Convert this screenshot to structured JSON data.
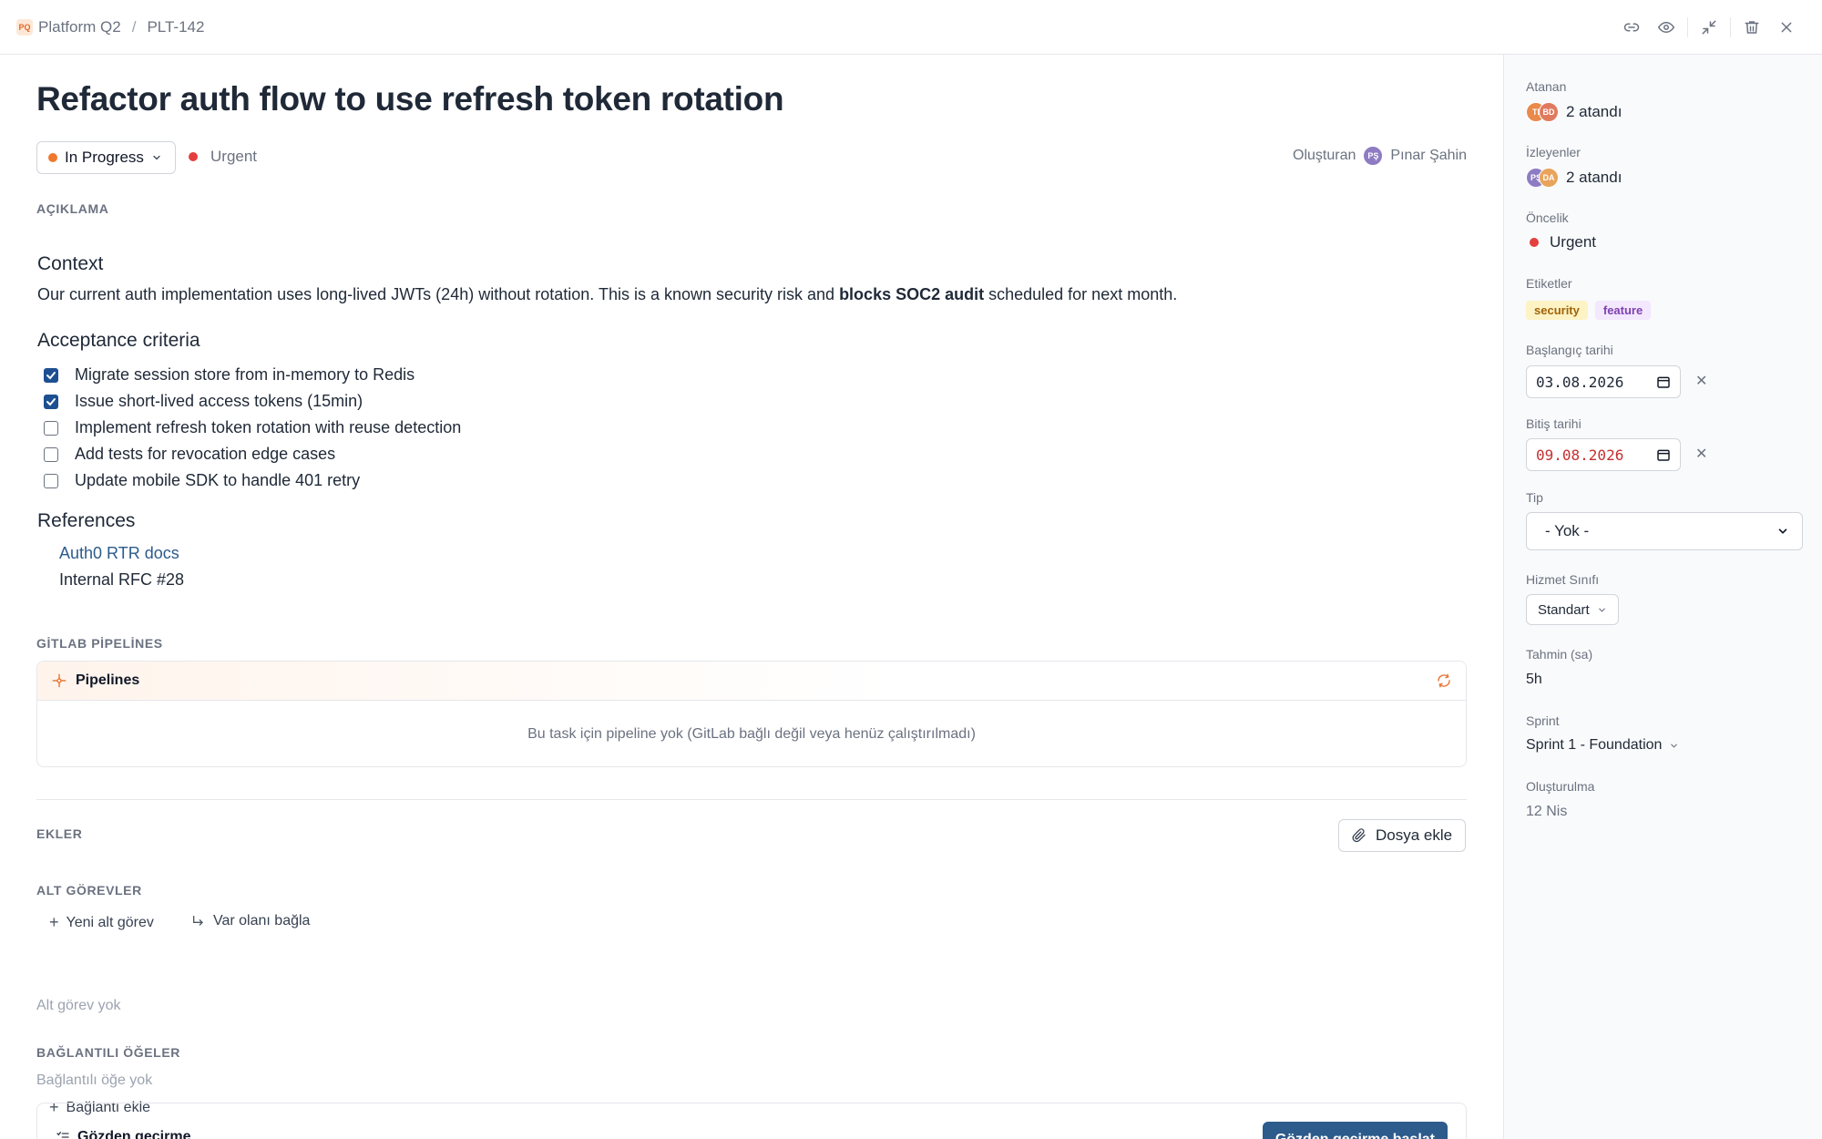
{
  "breadcrumb": {
    "project_badge": "PQ",
    "project": "Platform Q2",
    "separator": "/",
    "issue_key": "PLT-142"
  },
  "issue": {
    "title": "Refactor auth flow to use refresh token rotation",
    "status": "In Progress",
    "status_color": "#f0782e",
    "priority": "Urgent",
    "priority_color": "#e53e3e",
    "creator_label": "Oluşturan",
    "creator_initials": "PŞ",
    "creator_name": "Pınar Şahin"
  },
  "description": {
    "label": "AÇIKLAMA",
    "context_heading": "Context",
    "context_text_before": "Our current auth implementation uses long-lived JWTs (24h) without rotation. This is a known security risk and ",
    "context_text_bold": "blocks SOC2 audit",
    "context_text_after": " scheduled for next month.",
    "acceptance_heading": "Acceptance criteria",
    "checklist": [
      {
        "text": "Migrate session store from in-memory to Redis",
        "checked": true
      },
      {
        "text": "Issue short-lived access tokens (15min)",
        "checked": true
      },
      {
        "text": "Implement refresh token rotation with reuse detection",
        "checked": false
      },
      {
        "text": "Add tests for revocation edge cases",
        "checked": false
      },
      {
        "text": "Update mobile SDK to handle 401 retry",
        "checked": false
      }
    ],
    "references_heading": "References",
    "references": [
      {
        "text": "Auth0 RTR docs",
        "link": true
      },
      {
        "text": "Internal RFC #28",
        "link": false
      }
    ]
  },
  "gitlab": {
    "label": "GİTLAB PİPELİNES",
    "panel_title": "Pipelines",
    "empty_text": "Bu task için pipeline yok (GitLab bağlı değil veya henüz çalıştırılmadı)"
  },
  "attachments": {
    "label": "EKLER",
    "add_button": "Dosya ekle"
  },
  "subtasks": {
    "label": "ALT GÖREVLER",
    "new_button": "Yeni alt görev",
    "link_button": "Var olanı bağla",
    "empty": "Alt görev yok"
  },
  "linked": {
    "label": "BAĞLANTILI ÖĞELER",
    "empty": "Bağlantılı öğe yok",
    "add_button": "Bağlantı ekle"
  },
  "review": {
    "title": "Gözden geçirme",
    "start_button": "Gözden geçirme başlat"
  },
  "sidebar": {
    "assignee_label": "Atanan",
    "assignee_avatars": [
      {
        "initials": "TI",
        "color": "#e9894a"
      },
      {
        "initials": "BD",
        "color": "#e07a5f"
      }
    ],
    "assignee_value": "2 atandı",
    "watchers_label": "İzleyenler",
    "watcher_avatars": [
      {
        "initials": "PŞ",
        "color": "#8e7cc3"
      },
      {
        "initials": "DA",
        "color": "#e8a45c"
      }
    ],
    "watchers_value": "2 atandı",
    "priority_label": "Öncelik",
    "priority_value": "Urgent",
    "labels_label": "Etiketler",
    "tags": [
      {
        "text": "security",
        "bg": "#fdf3c4",
        "fg": "#a16207"
      },
      {
        "text": "feature",
        "bg": "#f3e8fd",
        "fg": "#7e3fb0"
      }
    ],
    "start_label": "Başlangıç tarihi",
    "start_value": "03.08.2026",
    "end_label": "Bitiş tarihi",
    "end_value": "09.08.2026",
    "end_color": "#c53030",
    "type_label": "Tip",
    "type_value": "- Yok -",
    "service_label": "Hizmet Sınıfı",
    "service_value": "Standart",
    "estimate_label": "Tahmin (sa)",
    "estimate_value": "5h",
    "sprint_label": "Sprint",
    "sprint_value": "Sprint 1 - Foundation",
    "created_label": "Oluşturulma",
    "created_value": "12 Nis"
  }
}
